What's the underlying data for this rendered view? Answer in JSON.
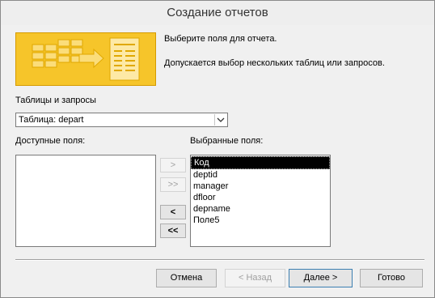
{
  "window": {
    "title": "Создание отчетов"
  },
  "instructions": {
    "line1": "Выберите поля для отчета.",
    "line2": "Допускается выбор нескольких таблиц или запросов."
  },
  "tables_label": "Таблицы и запросы",
  "tables_combo": {
    "selected": "Таблица: depart"
  },
  "available_label": "Доступные поля:",
  "available_fields": [],
  "selected_label": "Выбранные поля:",
  "selected_fields": [
    "Код",
    "deptid",
    "manager",
    "dfloor",
    "depname",
    "Поле5"
  ],
  "move_buttons": {
    "add_one": ">",
    "add_all": ">>",
    "remove_one": "<",
    "remove_all": "<<"
  },
  "footer": {
    "cancel": "Отмена",
    "back": "< Назад",
    "next": "Далее >",
    "finish": "Готово"
  },
  "colors": {
    "banner_fill": "#f6c52a",
    "banner_border": "#d59a00",
    "selection": "#000000"
  }
}
